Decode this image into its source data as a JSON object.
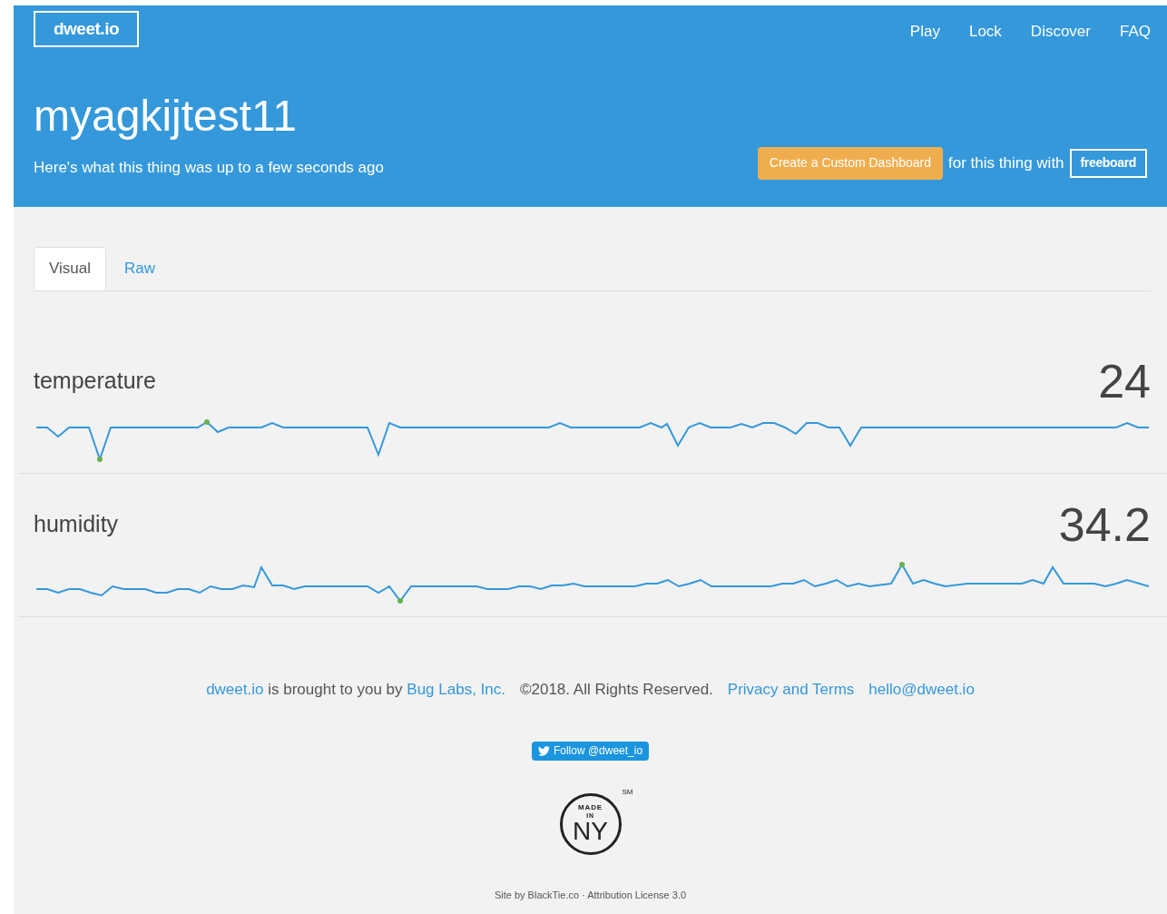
{
  "header": {
    "logo": "dweet.io",
    "nav": [
      "Play",
      "Lock",
      "Discover",
      "FAQ"
    ],
    "title": "myagkijtest11",
    "subtitle": "Here's what this thing was up to a few seconds ago",
    "dashboard_button": "Create a Custom Dashboard",
    "with_text": "for this thing with",
    "freeboard_button": "freeboard"
  },
  "tabs": [
    {
      "label": "Visual",
      "selected": true
    },
    {
      "label": "Raw",
      "selected": false
    }
  ],
  "metrics": [
    {
      "name": "temperature",
      "value": "24"
    },
    {
      "name": "humidity",
      "value": "34.2"
    }
  ],
  "footer": {
    "credit": [
      {
        "kind": "link",
        "text": "dweet.io"
      },
      {
        "kind": "text",
        "text": " is brought to you by "
      },
      {
        "kind": "link",
        "text": "Bug Labs, Inc."
      }
    ],
    "copyright": "©2018. All Rights Reserved.",
    "links": [
      "Privacy and Terms",
      "hello@dweet.io"
    ],
    "follow_button": "Follow @dweet_io",
    "badge": {
      "top": "MADE",
      "middle": "IN",
      "bottom": "NY",
      "mark": "SM"
    },
    "site_credit": "Site by BlackTie.co · Attribution License 3.0"
  }
}
